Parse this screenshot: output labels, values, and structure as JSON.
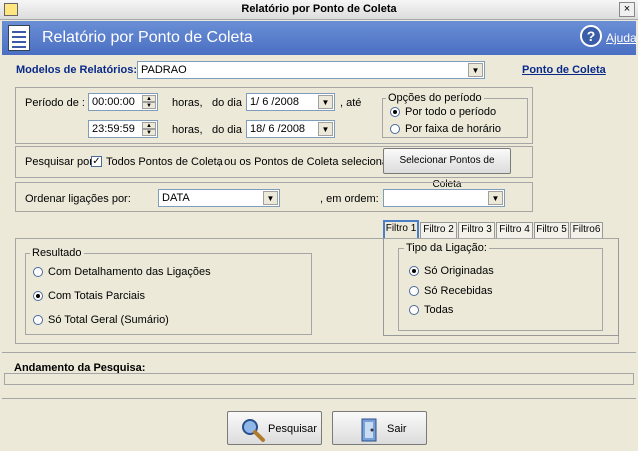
{
  "window": {
    "title": "Relatório por Ponto de Coleta",
    "close": "×"
  },
  "header": {
    "title": "Relatório por Ponto de Coleta",
    "help": "Ajuda"
  },
  "models": {
    "label": "Modelos de Relatórios:",
    "value": "PADRAO",
    "link": "Ponto de Coleta"
  },
  "period": {
    "label": "Período de :",
    "start_time": "00:00:00",
    "end_time": "23:59:59",
    "hours_label": "horas,",
    "day_label": "do dia",
    "start_date": "1/ 6 /2008",
    "end_date": "18/ 6 /2008",
    "until_label": ", até"
  },
  "period_options": {
    "title": "Opções do período",
    "opt_all": "Por todo o período",
    "opt_range": "Por faixa de horário"
  },
  "search": {
    "label": "Pesquisar por:",
    "all_points": "Todos Pontos de Coleta",
    "or_selected": ", ou os Pontos de Coleta selecionados:",
    "select_button": "Selecionar Pontos de Coleta"
  },
  "order": {
    "label": "Ordenar ligações por:",
    "value": "DATA",
    "in_order_label": ", em ordem:",
    "in_order_value": ""
  },
  "result": {
    "title": "Resultado",
    "opt_detail": "Com Detalhamento das Ligações",
    "opt_partial": "Com Totais  Parciais",
    "opt_total": "Só Total  Geral (Sumário)"
  },
  "filters": {
    "tabs": [
      "Filtro 1",
      "Filtro 2",
      "Filtro 3",
      "Filtro 4",
      "Filtro 5",
      "Filtro6"
    ],
    "group_title": "Tipo da Ligação:",
    "opt_originated": "Só Originadas",
    "opt_received": "Só Recebidas",
    "opt_all": "Todas"
  },
  "progress": {
    "label": "Andamento da Pesquisa:"
  },
  "actions": {
    "search": "Pesquisar",
    "exit": "Sair"
  }
}
